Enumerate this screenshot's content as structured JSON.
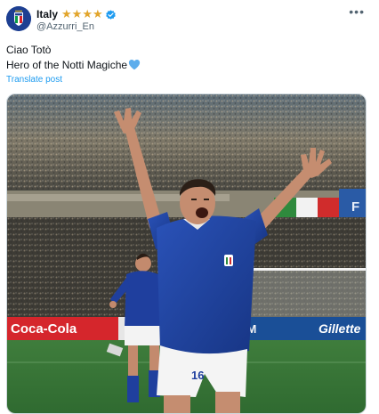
{
  "author": {
    "display_name": "Italy",
    "handle": "@Azzurri_En",
    "rating_stars": 4,
    "verified": true,
    "avatar_icon": "figc-crest-icon"
  },
  "post": {
    "lines": [
      "Ciao Totò",
      "Hero of the Notti Magiche"
    ],
    "emoji": "blue-heart-icon",
    "translate_label": "Translate post"
  },
  "media": {
    "ad_boards": [
      "Coca-Cola",
      "FILM",
      "Gillette"
    ],
    "flag_text": "F",
    "player_number": "16"
  },
  "colors": {
    "accent": "#1d9bf0",
    "star": "#e2a52b",
    "kit_blue": "#1f3f9e"
  }
}
